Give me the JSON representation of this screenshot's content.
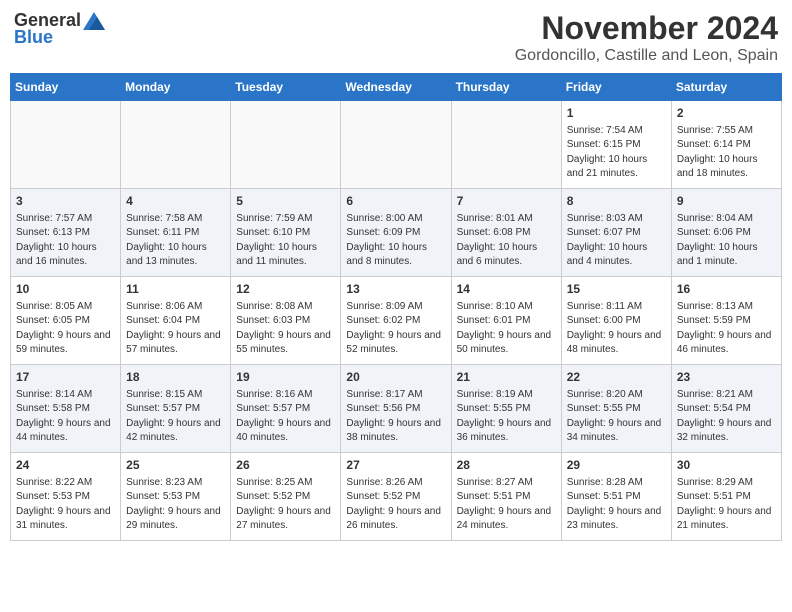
{
  "header": {
    "logo_general": "General",
    "logo_blue": "Blue",
    "title": "November 2024",
    "subtitle": "Gordoncillo, Castille and Leon, Spain"
  },
  "calendar": {
    "days_of_week": [
      "Sunday",
      "Monday",
      "Tuesday",
      "Wednesday",
      "Thursday",
      "Friday",
      "Saturday"
    ],
    "weeks": [
      [
        {
          "day": "",
          "info": ""
        },
        {
          "day": "",
          "info": ""
        },
        {
          "day": "",
          "info": ""
        },
        {
          "day": "",
          "info": ""
        },
        {
          "day": "",
          "info": ""
        },
        {
          "day": "1",
          "info": "Sunrise: 7:54 AM\nSunset: 6:15 PM\nDaylight: 10 hours and 21 minutes."
        },
        {
          "day": "2",
          "info": "Sunrise: 7:55 AM\nSunset: 6:14 PM\nDaylight: 10 hours and 18 minutes."
        }
      ],
      [
        {
          "day": "3",
          "info": "Sunrise: 7:57 AM\nSunset: 6:13 PM\nDaylight: 10 hours and 16 minutes."
        },
        {
          "day": "4",
          "info": "Sunrise: 7:58 AM\nSunset: 6:11 PM\nDaylight: 10 hours and 13 minutes."
        },
        {
          "day": "5",
          "info": "Sunrise: 7:59 AM\nSunset: 6:10 PM\nDaylight: 10 hours and 11 minutes."
        },
        {
          "day": "6",
          "info": "Sunrise: 8:00 AM\nSunset: 6:09 PM\nDaylight: 10 hours and 8 minutes."
        },
        {
          "day": "7",
          "info": "Sunrise: 8:01 AM\nSunset: 6:08 PM\nDaylight: 10 hours and 6 minutes."
        },
        {
          "day": "8",
          "info": "Sunrise: 8:03 AM\nSunset: 6:07 PM\nDaylight: 10 hours and 4 minutes."
        },
        {
          "day": "9",
          "info": "Sunrise: 8:04 AM\nSunset: 6:06 PM\nDaylight: 10 hours and 1 minute."
        }
      ],
      [
        {
          "day": "10",
          "info": "Sunrise: 8:05 AM\nSunset: 6:05 PM\nDaylight: 9 hours and 59 minutes."
        },
        {
          "day": "11",
          "info": "Sunrise: 8:06 AM\nSunset: 6:04 PM\nDaylight: 9 hours and 57 minutes."
        },
        {
          "day": "12",
          "info": "Sunrise: 8:08 AM\nSunset: 6:03 PM\nDaylight: 9 hours and 55 minutes."
        },
        {
          "day": "13",
          "info": "Sunrise: 8:09 AM\nSunset: 6:02 PM\nDaylight: 9 hours and 52 minutes."
        },
        {
          "day": "14",
          "info": "Sunrise: 8:10 AM\nSunset: 6:01 PM\nDaylight: 9 hours and 50 minutes."
        },
        {
          "day": "15",
          "info": "Sunrise: 8:11 AM\nSunset: 6:00 PM\nDaylight: 9 hours and 48 minutes."
        },
        {
          "day": "16",
          "info": "Sunrise: 8:13 AM\nSunset: 5:59 PM\nDaylight: 9 hours and 46 minutes."
        }
      ],
      [
        {
          "day": "17",
          "info": "Sunrise: 8:14 AM\nSunset: 5:58 PM\nDaylight: 9 hours and 44 minutes."
        },
        {
          "day": "18",
          "info": "Sunrise: 8:15 AM\nSunset: 5:57 PM\nDaylight: 9 hours and 42 minutes."
        },
        {
          "day": "19",
          "info": "Sunrise: 8:16 AM\nSunset: 5:57 PM\nDaylight: 9 hours and 40 minutes."
        },
        {
          "day": "20",
          "info": "Sunrise: 8:17 AM\nSunset: 5:56 PM\nDaylight: 9 hours and 38 minutes."
        },
        {
          "day": "21",
          "info": "Sunrise: 8:19 AM\nSunset: 5:55 PM\nDaylight: 9 hours and 36 minutes."
        },
        {
          "day": "22",
          "info": "Sunrise: 8:20 AM\nSunset: 5:55 PM\nDaylight: 9 hours and 34 minutes."
        },
        {
          "day": "23",
          "info": "Sunrise: 8:21 AM\nSunset: 5:54 PM\nDaylight: 9 hours and 32 minutes."
        }
      ],
      [
        {
          "day": "24",
          "info": "Sunrise: 8:22 AM\nSunset: 5:53 PM\nDaylight: 9 hours and 31 minutes."
        },
        {
          "day": "25",
          "info": "Sunrise: 8:23 AM\nSunset: 5:53 PM\nDaylight: 9 hours and 29 minutes."
        },
        {
          "day": "26",
          "info": "Sunrise: 8:25 AM\nSunset: 5:52 PM\nDaylight: 9 hours and 27 minutes."
        },
        {
          "day": "27",
          "info": "Sunrise: 8:26 AM\nSunset: 5:52 PM\nDaylight: 9 hours and 26 minutes."
        },
        {
          "day": "28",
          "info": "Sunrise: 8:27 AM\nSunset: 5:51 PM\nDaylight: 9 hours and 24 minutes."
        },
        {
          "day": "29",
          "info": "Sunrise: 8:28 AM\nSunset: 5:51 PM\nDaylight: 9 hours and 23 minutes."
        },
        {
          "day": "30",
          "info": "Sunrise: 8:29 AM\nSunset: 5:51 PM\nDaylight: 9 hours and 21 minutes."
        }
      ]
    ]
  }
}
